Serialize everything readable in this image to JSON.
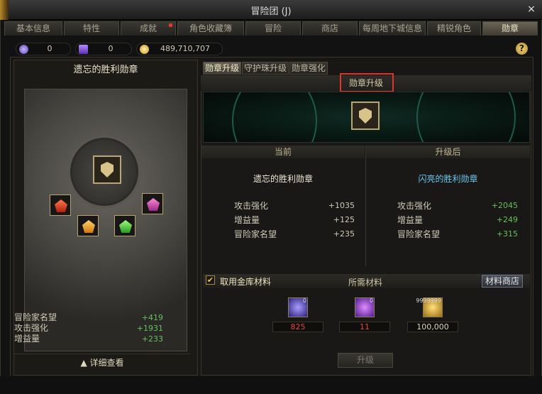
{
  "window": {
    "title": "冒险团 (J)",
    "close_icon": "×"
  },
  "tabs": [
    {
      "label": "基本信息"
    },
    {
      "label": "特性"
    },
    {
      "label": "成就",
      "has_alert": true
    },
    {
      "label": "角色收藏簿"
    },
    {
      "label": "冒险"
    },
    {
      "label": "商店"
    },
    {
      "label": "每周地下城信息"
    },
    {
      "label": "精锐角色"
    },
    {
      "label": "勋章",
      "active": true
    }
  ],
  "currency": {
    "gem_count": "0",
    "cube_count": "0",
    "gold": "489,710,707"
  },
  "help_label": "?",
  "left_panel": {
    "title": "遗忘的胜利勋章",
    "stats": [
      {
        "name": "冒险家名望",
        "value": "+419"
      },
      {
        "name": "攻击强化",
        "value": "+1931"
      },
      {
        "name": "增益量",
        "value": "+233"
      }
    ],
    "detail_label": "▲ 详细查看"
  },
  "subtabs": [
    {
      "label": "勋章升级",
      "active": true
    },
    {
      "label": "守护珠升级"
    },
    {
      "label": "勋章强化"
    }
  ],
  "upgrade_section": {
    "title": "勋章升级",
    "current_header": "当前",
    "after_header": "升级后",
    "current": {
      "name": "遗忘的胜利勋章",
      "stats": [
        {
          "name": "攻击强化",
          "value": "+1035"
        },
        {
          "name": "增益量",
          "value": "+125"
        },
        {
          "name": "冒险家名望",
          "value": "+235"
        }
      ]
    },
    "after": {
      "name": "闪亮的胜利勋章",
      "stats": [
        {
          "name": "攻击强化",
          "value": "+2045"
        },
        {
          "name": "增益量",
          "value": "+249"
        },
        {
          "name": "冒险家名望",
          "value": "+315"
        }
      ]
    }
  },
  "materials": {
    "use_vault_label": "取用金库材料",
    "use_vault_checked": true,
    "title": "所需材料",
    "shop_label": "材料商店",
    "items": [
      {
        "icon": "purple-orb-icon",
        "count_badge": "0",
        "required": "825",
        "insufficient": true
      },
      {
        "icon": "purple-cube-icon",
        "count_badge": "0",
        "required": "11",
        "insufficient": true
      },
      {
        "icon": "gold-coins-icon",
        "count_badge": "9999999",
        "required": "100,000",
        "insufficient": false
      }
    ],
    "upgrade_button": "升级"
  },
  "colors": {
    "accent_gold": "#d6c48b",
    "stat_green": "#63c25a",
    "insufficient_red": "#e04a3a",
    "after_name_blue": "#6ec8f0",
    "highlight_red": "#e2332a"
  }
}
